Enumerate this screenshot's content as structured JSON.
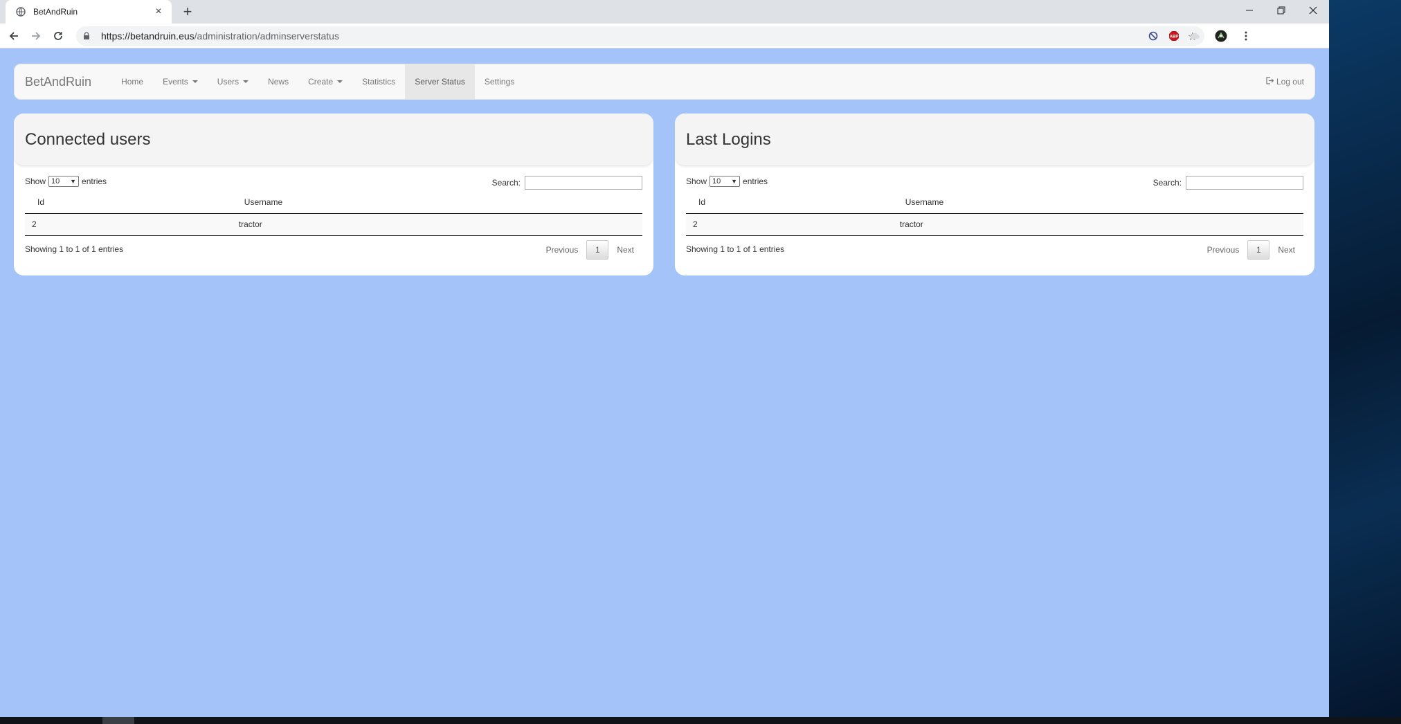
{
  "browser": {
    "tab_title": "BetAndRuin",
    "url_host": "https://betandruin.eus",
    "url_path": "/administration/adminserverstatus"
  },
  "navbar": {
    "brand": "BetAndRuin",
    "items": [
      {
        "label": "Home"
      },
      {
        "label": "Events"
      },
      {
        "label": "Users"
      },
      {
        "label": "News"
      },
      {
        "label": "Create"
      },
      {
        "label": "Statistics"
      },
      {
        "label": "Server Status"
      },
      {
        "label": "Settings"
      }
    ],
    "logout": "Log out"
  },
  "panels": [
    {
      "title": "Connected users",
      "show_label": "Show",
      "entries_value": "10",
      "entries_label": "entries",
      "search_label": "Search:",
      "columns": [
        "Id",
        "Username"
      ],
      "rows": [
        [
          "2",
          "tractor"
        ]
      ],
      "info": "Showing 1 to 1 of 1 entries",
      "previous": "Previous",
      "page": "1",
      "next": "Next"
    },
    {
      "title": "Last Logins",
      "show_label": "Show",
      "entries_value": "10",
      "entries_label": "entries",
      "search_label": "Search:",
      "columns": [
        "Id",
        "Username"
      ],
      "rows": [
        [
          "2",
          "tractor"
        ]
      ],
      "info": "Showing 1 to 1 of 1 entries",
      "previous": "Previous",
      "page": "1",
      "next": "Next"
    }
  ]
}
